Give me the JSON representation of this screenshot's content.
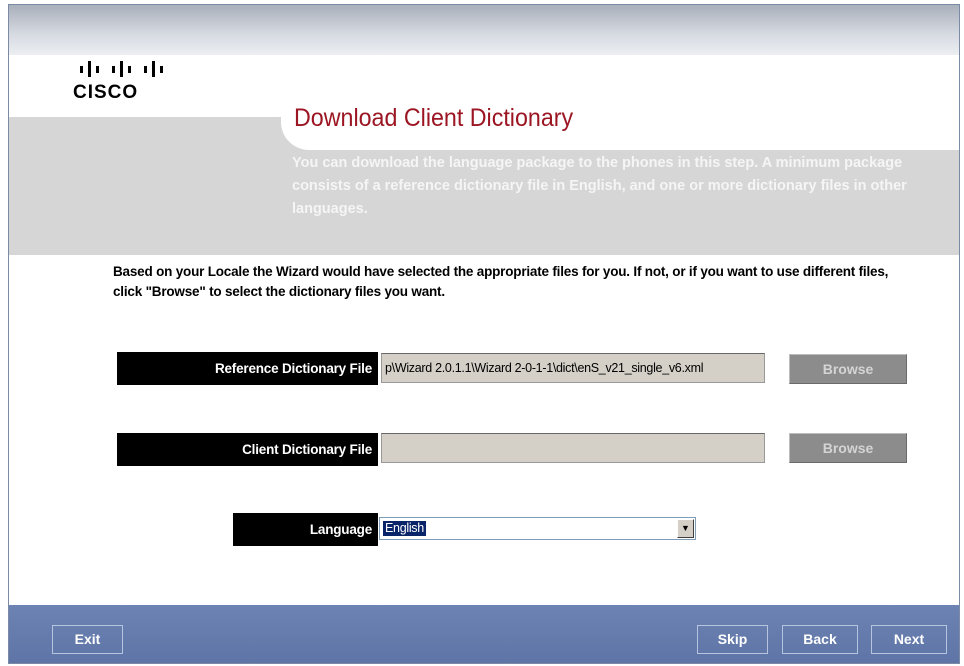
{
  "brand": {
    "logo_text": "CISCO"
  },
  "header": {
    "title": "Download Client Dictionary",
    "description": "You can download the language package to the phones in this step. A minimum package consists of a reference dictionary file in English, and one or more dictionary files in other languages."
  },
  "instructions": "Based on your Locale the Wizard would have selected the appropriate files for you. If not, or if you want to use different files, click \"Browse\" to select the dictionary files you want.",
  "fields": {
    "reference_dictionary": {
      "label": "Reference Dictionary File",
      "value": "p\\Wizard 2.0.1.1\\Wizard 2-0-1-1\\dict\\enS_v21_single_v6.xml",
      "browse_label": "Browse"
    },
    "client_dictionary": {
      "label": "Client Dictionary File",
      "value": "",
      "browse_label": "Browse"
    },
    "language": {
      "label": "Language",
      "selected": "English"
    }
  },
  "footer": {
    "exit_label": "Exit",
    "skip_label": "Skip",
    "back_label": "Back",
    "next_label": "Next"
  },
  "colors": {
    "title_red": "#9b1622",
    "header_gray": "#d6d6d6",
    "footer_blue": "#6d83b3",
    "label_black": "#000000"
  }
}
